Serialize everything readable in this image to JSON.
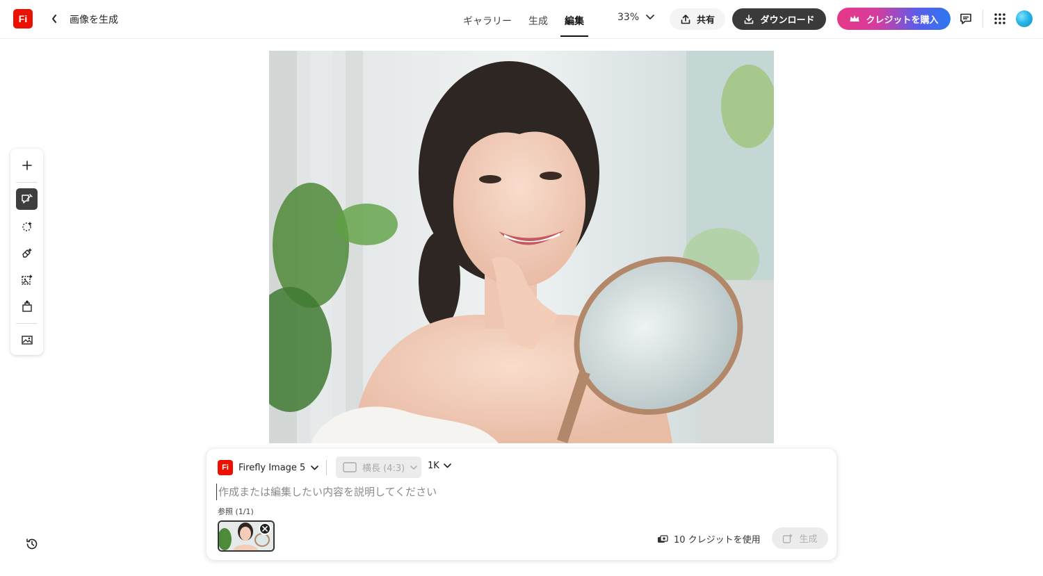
{
  "app": {
    "logo_text": "Fi",
    "page_title": "画像を生成",
    "brand_color": "#eb1000"
  },
  "nav": {
    "tabs": [
      {
        "label": "ギャラリー",
        "active": false
      },
      {
        "label": "生成",
        "active": false
      },
      {
        "label": "編集",
        "active": true
      }
    ]
  },
  "toolbar": {
    "zoom": "33%",
    "share_label": "共有",
    "download_label": "ダウンロード",
    "buy_credits_label": "クレジットを購入"
  },
  "tool_rail": {
    "items": [
      {
        "icon": "plus-icon",
        "active": false
      },
      {
        "icon": "prompt-edit-icon",
        "active": true
      },
      {
        "icon": "select-subject-icon",
        "active": false
      },
      {
        "icon": "eraser-icon",
        "active": false
      },
      {
        "icon": "generative-fill-icon",
        "active": false
      },
      {
        "icon": "expand-icon",
        "active": false
      },
      {
        "icon": "image-adjust-icon",
        "active": false
      }
    ]
  },
  "prompt_panel": {
    "model_label": "Firefly Image 5",
    "aspect_label": "横長 (4:3)",
    "resolution_label": "1K",
    "prompt_value": "",
    "prompt_placeholder": "作成または編集したい内容を説明してください",
    "reference_label": "参照 (1/1)",
    "credits_text": "10 クレジットを使用",
    "generate_label": "生成"
  }
}
